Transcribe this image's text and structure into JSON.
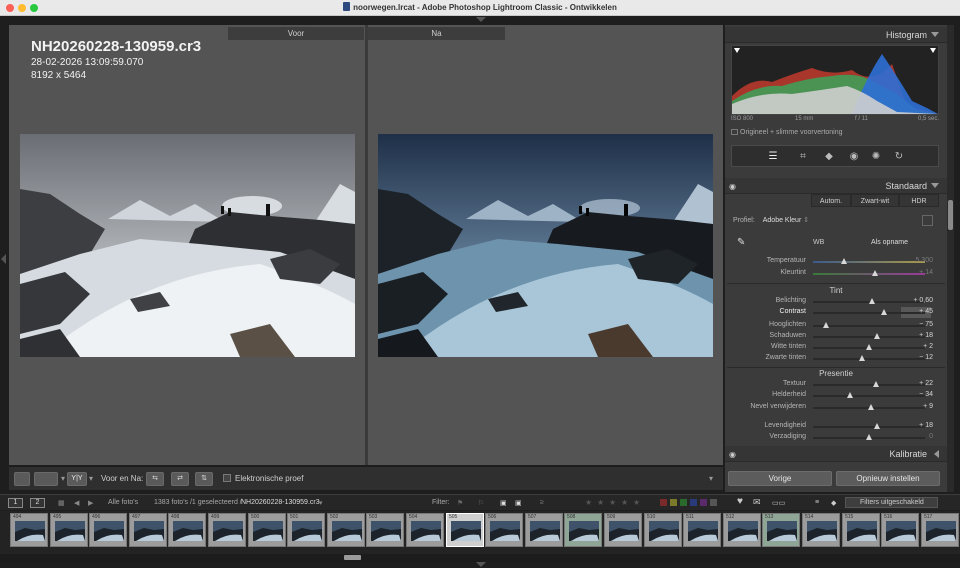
{
  "window": {
    "title": "noorwegen.lrcat - Adobe Photoshop Lightroom Classic - Ontwikkelen"
  },
  "compare": {
    "before_label": "Voor",
    "after_label": "Na",
    "filename": "NH20260228-130959.cr3",
    "datetime": "28-02-2026 13:09:59.070",
    "dimensions": "8192 x 5464"
  },
  "toolbar": {
    "before_after_label": "Voor en Na:",
    "softproof_label": "Elektronische proef",
    "yy_label": "Y|Y"
  },
  "histogram": {
    "title": "Histogram",
    "iso": "ISO 800",
    "focal": "15 mm",
    "aperture": "f / 11",
    "shutter": "0,5 sec.",
    "preview_label": "Origineel + slimme voorvertoning"
  },
  "basic": {
    "title": "Standaard",
    "auto_label": "Autom.",
    "bw_label": "Zwart-wit",
    "hdr_label": "HDR",
    "profile_label": "Profiel:",
    "profile_value": "Adobe Kleur",
    "wb_label": "WB",
    "wb_value": "Als opname",
    "tone_label": "Tint",
    "presence_label": "Presentie",
    "sliders": {
      "temperature": {
        "label": "Temperatuur",
        "value": "5.300",
        "pos": 0.28
      },
      "tint": {
        "label": "Kleurtint",
        "value": "+ 14",
        "pos": 0.55
      },
      "exposure": {
        "label": "Belichting",
        "value": "+ 0,60",
        "pos": 0.53
      },
      "contrast": {
        "label": "Contrast",
        "value": "+ 45",
        "pos": 0.63
      },
      "highlights": {
        "label": "Hooglichten",
        "value": "− 75",
        "pos": 0.12
      },
      "shadows": {
        "label": "Schaduwen",
        "value": "+ 18",
        "pos": 0.57
      },
      "whites": {
        "label": "Witte tinten",
        "value": "+ 2",
        "pos": 0.5
      },
      "blacks": {
        "label": "Zwarte tinten",
        "value": "− 12",
        "pos": 0.44
      },
      "texture": {
        "label": "Textuur",
        "value": "+ 22",
        "pos": 0.56
      },
      "clarity": {
        "label": "Helderheid",
        "value": "− 34",
        "pos": 0.33
      },
      "dehaze": {
        "label": "Nevel verwijderen",
        "value": "+ 9",
        "pos": 0.52
      },
      "vibrance": {
        "label": "Levendigheid",
        "value": "+ 18",
        "pos": 0.57
      },
      "saturation": {
        "label": "Verzadiging",
        "value": "0",
        "pos": 0.5
      }
    }
  },
  "calibration": {
    "title": "Kalibratie"
  },
  "nav": {
    "prev_label": "Vorige",
    "reset_label": "Opnieuw instellen"
  },
  "filmstrip_bar": {
    "screen1": "1",
    "screen2": "2",
    "source": "Alle foto's",
    "count": "1383 foto's /1 geselecteerd /",
    "current": "NH20260228-130959.cr3",
    "filter_label": "Filter:",
    "filter_value": "Filters uitgeschakeld"
  },
  "filmstrip": {
    "thumbs": [
      {
        "num": "494",
        "state": "normal"
      },
      {
        "num": "495",
        "state": "normal"
      },
      {
        "num": "496",
        "state": "normal"
      },
      {
        "num": "497",
        "state": "normal"
      },
      {
        "num": "498",
        "state": "normal"
      },
      {
        "num": "499",
        "state": "normal"
      },
      {
        "num": "500",
        "state": "normal"
      },
      {
        "num": "501",
        "state": "normal"
      },
      {
        "num": "502",
        "state": "normal"
      },
      {
        "num": "503",
        "state": "normal"
      },
      {
        "num": "504",
        "state": "normal"
      },
      {
        "num": "505",
        "state": "selected"
      },
      {
        "num": "506",
        "state": "normal"
      },
      {
        "num": "507",
        "state": "normal"
      },
      {
        "num": "508",
        "state": "tinted"
      },
      {
        "num": "509",
        "state": "normal"
      },
      {
        "num": "510",
        "state": "normal"
      },
      {
        "num": "511",
        "state": "normal"
      },
      {
        "num": "512",
        "state": "normal"
      },
      {
        "num": "513",
        "state": "tinted"
      },
      {
        "num": "514",
        "state": "normal"
      },
      {
        "num": "515",
        "state": "normal"
      },
      {
        "num": "516",
        "state": "normal"
      },
      {
        "num": "517",
        "state": "normal"
      }
    ]
  },
  "colors": {
    "accent": "#cfcfcf",
    "panel_bg": "#3b3b3b",
    "canvas_bg": "#545454"
  }
}
